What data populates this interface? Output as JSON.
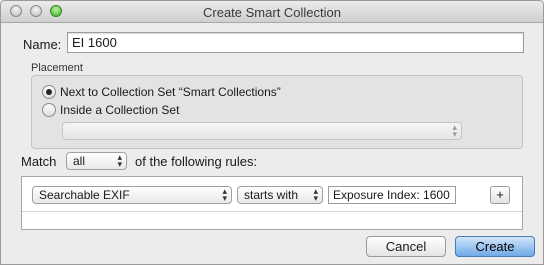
{
  "window": {
    "title": "Create Smart Collection"
  },
  "name": {
    "label": "Name:",
    "value": "EI 1600"
  },
  "placement": {
    "label": "Placement",
    "options": [
      {
        "label": "Next to Collection Set “Smart Collections”",
        "selected": true
      },
      {
        "label": "Inside a Collection Set",
        "selected": false
      }
    ],
    "collection_set_select": {
      "value": ""
    }
  },
  "match": {
    "label": "Match",
    "value": "all",
    "suffix": "of the following rules:"
  },
  "rule": {
    "field": "Searchable EXIF",
    "operator": "starts with",
    "value": "Exposure Index: 1600",
    "add_label": "+"
  },
  "buttons": {
    "cancel": "Cancel",
    "create": "Create"
  },
  "colors": {
    "default_button": "#6fa8e8"
  },
  "icons": {
    "popup_arrows": "updown-chevron-icon"
  }
}
